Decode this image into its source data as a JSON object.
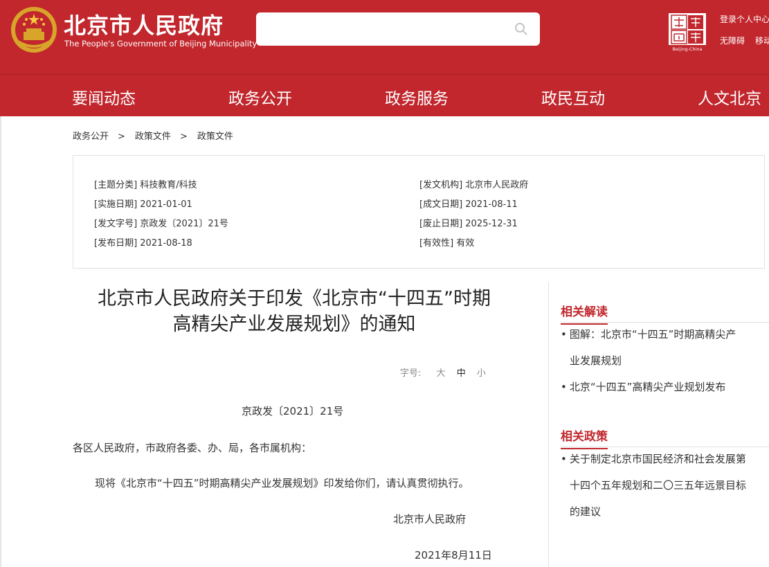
{
  "header": {
    "site_title": "北京市人民政府",
    "site_subtitle": "The People's Government of Beijing Municipality",
    "login_label": "登录个人中心",
    "accessibility_label": "无障碍",
    "mobile_label": "移动",
    "seal_text": "Beijing-China",
    "search_placeholder": ""
  },
  "nav": {
    "items": [
      {
        "label": "要闻动态"
      },
      {
        "label": "政务公开"
      },
      {
        "label": "政务服务"
      },
      {
        "label": "政民互动"
      },
      {
        "label": "人文北京"
      }
    ]
  },
  "breadcrumb": {
    "items": [
      "政务公开",
      "政策文件",
      "政策文件"
    ],
    "separator": ">"
  },
  "info": {
    "topic": "[主题分类] 科技教育/科技",
    "effective_date": "[实施日期] 2021-01-01",
    "doc_no": "[发文字号] 京政发〔2021〕21号",
    "publish_date": "[发布日期] 2021-08-18",
    "issuer": "[发文机构] 北京市人民政府",
    "written_date": "[成文日期] 2021-08-11",
    "expire_date": "[废止日期] 2025-12-31",
    "validity": "[有效性] 有效"
  },
  "article": {
    "title_line1": "北京市人民政府关于印发《北京市“十四五”时期",
    "title_line2": "高精尖产业发展规划》的通知",
    "font_label": "字号:",
    "font_large": "大",
    "font_medium": "中",
    "font_small": "小",
    "doc_number": "京政发〔2021〕21号",
    "addressee": "各区人民政府，市政府各委、办、局，各市属机构：",
    "body": "现将《北京市“十四五”时期高精尖产业发展规划》印发给你们，请认真贯彻执行。",
    "signer": "北京市人民政府",
    "date": "2021年8月11日"
  },
  "sidebar": {
    "interpretation_heading": "相关解读",
    "interpretation_items": [
      {
        "line1": "图解：北京市“十四五”时期高精尖产",
        "line2": "业发展规划"
      },
      {
        "line1": "北京“十四五”高精尖产业规划发布",
        "line2": ""
      }
    ],
    "policy_heading": "相关政策",
    "policy_items": [
      {
        "line1": "关于制定北京市国民经济和社会发展第",
        "line2": "十四个五年规划和二〇三五年远景目标",
        "line3": "的建议"
      }
    ],
    "bullet": "•"
  },
  "colors": {
    "brand_red": "#c1272d",
    "text": "#333333"
  }
}
